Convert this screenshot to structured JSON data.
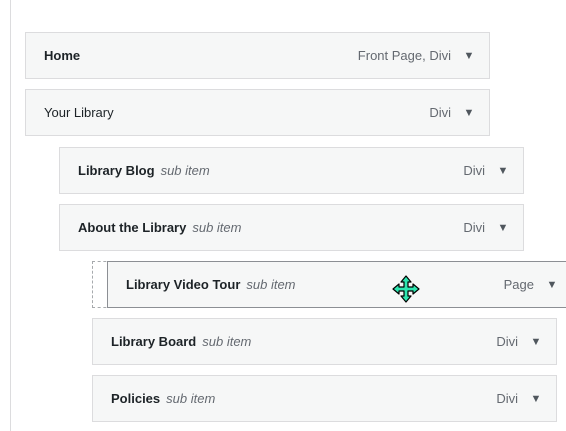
{
  "menu": {
    "items": [
      {
        "label": "Home",
        "type": "Front Page, Divi"
      },
      {
        "label": "Your Library",
        "type": "Divi"
      },
      {
        "label": "Library Blog",
        "sub": "sub item",
        "type": "Divi"
      },
      {
        "label": "About the Library",
        "sub": "sub item",
        "type": "Divi"
      },
      {
        "label": "Library Video Tour",
        "sub": "sub item",
        "type": "Page"
      },
      {
        "label": "Library Board",
        "sub": "sub item",
        "type": "Divi"
      },
      {
        "label": "Policies",
        "sub": "sub item",
        "type": "Divi"
      }
    ],
    "arrow_glyph": "▼"
  },
  "cursor": {
    "icon": "move-cursor-icon",
    "color": "#2ee6b0"
  }
}
